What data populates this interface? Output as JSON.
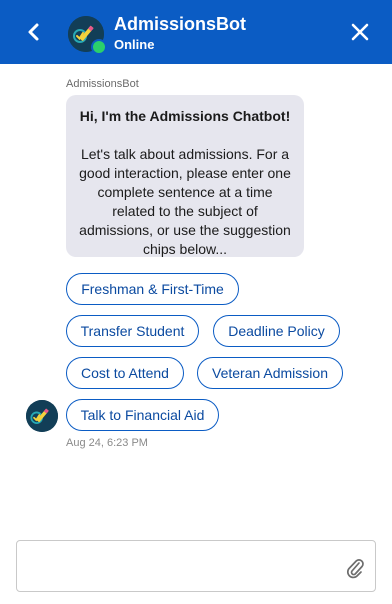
{
  "header": {
    "bot_name": "AdmissionsBot",
    "status": "Online",
    "back_icon": "chevron-left-icon",
    "close_icon": "close-icon",
    "bar_color": "#0b5cc4",
    "online_color": "#2bd06b"
  },
  "message": {
    "sender": "AdmissionsBot",
    "title": "Hi, I'm the Admissions Chatbot!",
    "body": "Let's talk about admissions. For a good interaction, please enter one complete sentence at a time related to the subject of admissions, or use the suggestion chips below...",
    "timestamp": "Aug 24, 6:23 PM"
  },
  "chips": [
    "Freshman & First-Time",
    "Transfer Student",
    "Deadline Policy",
    "Cost to Attend",
    "Veteran Admission",
    "Talk to Financial Aid"
  ],
  "composer": {
    "value": "",
    "placeholder": "",
    "attach_icon": "paperclip-icon"
  }
}
